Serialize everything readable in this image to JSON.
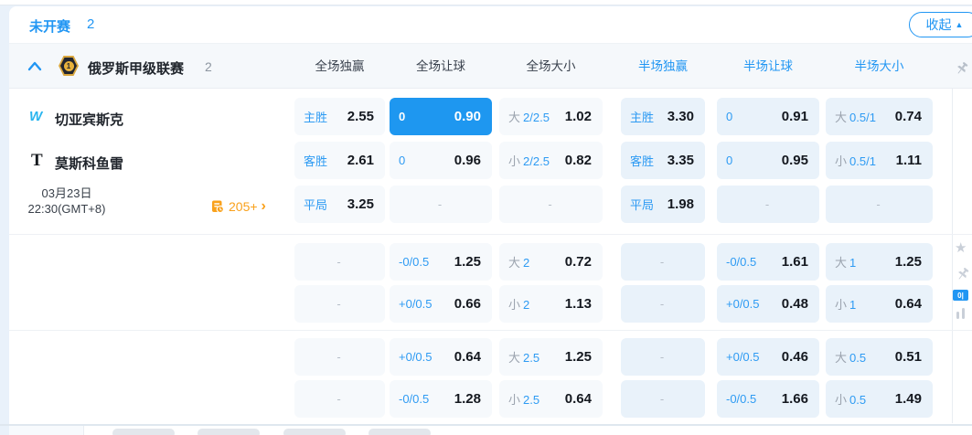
{
  "colors": {
    "accent": "#2196f3",
    "selected_cell": "#1e97f0",
    "half_cell_bg": "#e9f2fa",
    "full_cell_bg": "#f6f9fc",
    "value_text": "#14181f",
    "orange": "#f9a11b"
  },
  "status_bar": {
    "title": "未开赛",
    "count": "2",
    "collapse_label": "收起",
    "collapse_icon": "▲"
  },
  "league_header": {
    "name": "俄罗斯甲级联赛",
    "count": "2",
    "badge": "1",
    "columns": [
      {
        "label": "全场独赢",
        "scope": "full"
      },
      {
        "label": "全场让球",
        "scope": "full"
      },
      {
        "label": "全场大小",
        "scope": "full"
      },
      {
        "label": "半场独赢",
        "scope": "half"
      },
      {
        "label": "半场让球",
        "scope": "half"
      },
      {
        "label": "半场大小",
        "scope": "half"
      }
    ]
  },
  "match": {
    "home_team": "切亚宾斯克",
    "away_team": "莫斯科鱼雷",
    "home_logo_glyph": "W",
    "away_logo_glyph": "T",
    "date": "03月23日",
    "time": "22:30(GMT+8)",
    "more_markets": "205+",
    "more_chevron": "›"
  },
  "odds_rows": [
    [
      {
        "l": "主胜",
        "v": "2.55"
      },
      {
        "l": "0",
        "v": "0.90",
        "sel": true
      },
      {
        "p": "大",
        "l": "2/2.5",
        "v": "1.02"
      },
      {
        "l": "主胜",
        "v": "3.30"
      },
      {
        "l": "0",
        "v": "0.91"
      },
      {
        "p": "大",
        "l": "0.5/1",
        "v": "0.74"
      }
    ],
    [
      {
        "l": "客胜",
        "v": "2.61"
      },
      {
        "l": "0",
        "v": "0.96"
      },
      {
        "p": "小",
        "l": "2/2.5",
        "v": "0.82"
      },
      {
        "l": "客胜",
        "v": "3.35"
      },
      {
        "l": "0",
        "v": "0.95"
      },
      {
        "p": "小",
        "l": "0.5/1",
        "v": "1.11"
      }
    ],
    [
      {
        "l": "平局",
        "v": "3.25"
      },
      null,
      null,
      {
        "l": "平局",
        "v": "1.98"
      },
      null,
      null
    ],
    [
      null,
      {
        "l": "-0/0.5",
        "v": "1.25"
      },
      {
        "p": "大",
        "l": "2",
        "v": "0.72"
      },
      null,
      {
        "l": "-0/0.5",
        "v": "1.61"
      },
      {
        "p": "大",
        "l": "1",
        "v": "1.25"
      }
    ],
    [
      null,
      {
        "l": "+0/0.5",
        "v": "0.66"
      },
      {
        "p": "小",
        "l": "2",
        "v": "1.13"
      },
      null,
      {
        "l": "+0/0.5",
        "v": "0.48"
      },
      {
        "p": "小",
        "l": "1",
        "v": "0.64"
      }
    ],
    [
      null,
      {
        "l": "+0/0.5",
        "v": "0.64"
      },
      {
        "p": "大",
        "l": "2.5",
        "v": "1.25"
      },
      null,
      {
        "l": "+0/0.5",
        "v": "0.46"
      },
      {
        "p": "大",
        "l": "0.5",
        "v": "0.51"
      }
    ],
    [
      null,
      {
        "l": "-0/0.5",
        "v": "1.28"
      },
      {
        "p": "小",
        "l": "2.5",
        "v": "0.64"
      },
      null,
      {
        "l": "-0/0.5",
        "v": "1.66"
      },
      {
        "p": "小",
        "l": "0.5",
        "v": "1.49"
      }
    ]
  ],
  "side_rail": {
    "badge": "0|"
  },
  "glyphs": {
    "dash": "-",
    "star": "★"
  }
}
